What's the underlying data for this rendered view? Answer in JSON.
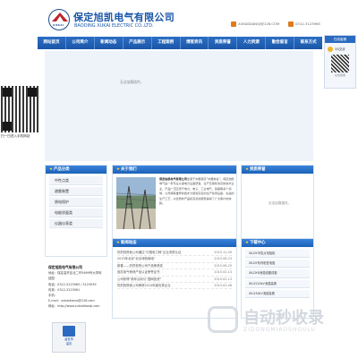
{
  "header": {
    "company_cn": "保定旭凯电气有限公司",
    "company_en": "BAODING XUKAI ELECTRIC CO.,LTD.",
    "logo_caption": "XUKAI",
    "email": "XUKAIDIANQI@126.COM",
    "phone": "0312-3123965",
    "accent": "#1a56a8"
  },
  "nav": {
    "items": [
      "网站首页",
      "公司简介",
      "新闻动态",
      "产品展示",
      "工程案例",
      "博客资讯",
      "资质荣誉",
      "人力资源",
      "勤俭留言",
      "联系方式"
    ]
  },
  "side_widget": {
    "title": "在线客服",
    "qq_label": "QQ交谈",
    "footer": "在线客服"
  },
  "qr": {
    "caption": "扫一扫进入手机网站"
  },
  "banner": {
    "message": "无法加载插件。"
  },
  "products": {
    "title": "产品分类",
    "items": [
      "中性点类",
      "避雷装置",
      "馈电保护",
      "电能质量类",
      "仪器仪表类"
    ]
  },
  "about": {
    "title": "关于我们",
    "company": "保定旭凯电气有限公司",
    "text": "坐落于中国保定“中国电谷”。保定旭凯电气是一家专业从事电力设备研发、生产及销售的高新技术企业，产品广泛应用于电力、电子、工业电气、铁路等多个领域，公司拥有雄厚的技术力量和完善的生产检测设备，先进的生产工艺，以优质的产品和完善的服务赢得了广大客户的信赖。"
  },
  "honor": {
    "title": "资质荣誉",
    "message": "无法加载插件。"
  },
  "contact": {
    "company": "保定旭凯电气有限公司",
    "address": "地址：保定高开区北二环5699号大学科技园",
    "tel": "电话：0312-3123965 / 3123939",
    "fax": "传真：0312-3123961",
    "mobile": "手机：",
    "email": "E-mail：xukaidianqi@126.com",
    "web": "网址：http://www.xukaidianqi.com"
  },
  "cert": {
    "line1": "留言簿",
    "line2": "留言"
  },
  "news": {
    "title": "新闻动态",
    "rows": [
      {
        "title": "热烈祝贺我公司通过“中国电力网”企业资质认证",
        "date": "2015-11-09"
      },
      {
        "title": "2015年北京“北京绿色输电”",
        "date": "2015-08-23"
      },
      {
        "title": "新春——热烈祝贺公司产品荣获奖",
        "date": "2015-06-25"
      },
      {
        "title": "旭凯电气荣获产品认证荣誉证书",
        "date": "2015-02-13"
      },
      {
        "title": "公司获得“新年活动与“国网投资”",
        "date": "2015-02-13"
      },
      {
        "title": "热烈祝贺我公司荣获2014年度优秀企业",
        "date": "2015-02-06"
      }
    ]
  },
  "downloads": {
    "title": "下载中心",
    "rows": [
      "XK-DY中性点电阻柜",
      "XK-DY系列柜型电阻",
      "XK-DYB消弧线圈成套",
      "XK-X220kV消弧装置",
      "XK-X30kV消弧装置"
    ]
  },
  "watermark": {
    "big": "自动秒收录",
    "small": "ZIDONGMIAOSHOULU"
  }
}
